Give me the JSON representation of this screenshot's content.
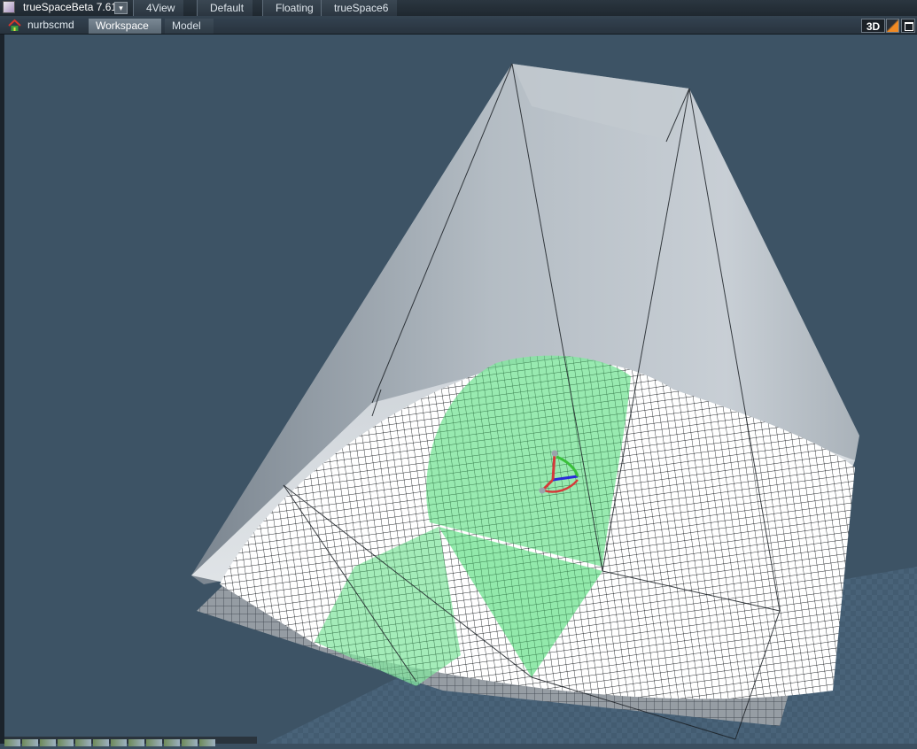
{
  "app": {
    "title": "trueSpaceBeta 7.61",
    "dropdown_glyph": "▾"
  },
  "layout_tabs": [
    "4View",
    "Default",
    "Floating",
    "trueSpace6"
  ],
  "toolbar": {
    "context_label": "nurbscmd",
    "view_tabs": [
      {
        "label": "Workspace",
        "active": true
      },
      {
        "label": "Model",
        "active": false
      }
    ],
    "view_mode_label": "3D"
  },
  "icons": {
    "app": "truespace-app-icon",
    "context": "house-icon",
    "view_mode_toggle": "corner-triangle-icon",
    "maximize": "maximize-icon",
    "gizmo": "transform-gizmo-icon"
  },
  "scene": {
    "background_color": "#3d5365",
    "surface_color": "#ffffff",
    "selection_color": "#7de39a",
    "cage_color": "#c9d1d8"
  }
}
